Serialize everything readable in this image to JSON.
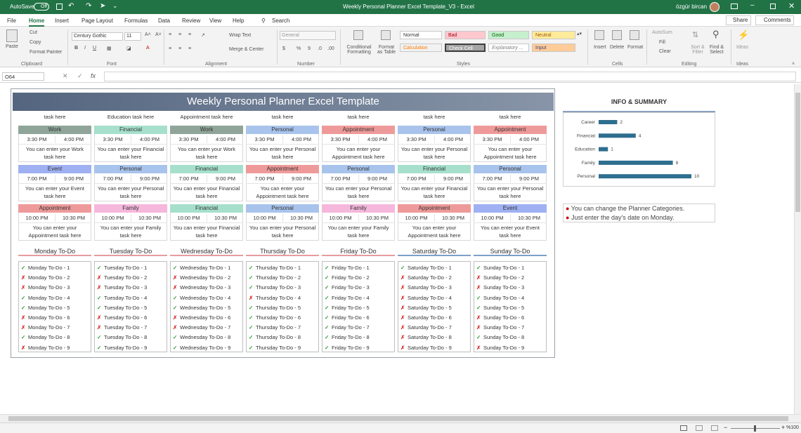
{
  "window": {
    "autosave_label": "AutoSave",
    "autosave_state": "Off",
    "title": "Weekly Personal Planner Excel Template_V3  -  Excel",
    "user": "özgür bircan"
  },
  "menu": {
    "tabs": [
      "File",
      "Home",
      "Insert",
      "Page Layout",
      "Formulas",
      "Data",
      "Review",
      "View",
      "Help"
    ],
    "search": "Search",
    "share": "Share",
    "comments": "Comments"
  },
  "ribbon": {
    "clipboard": {
      "paste": "Paste",
      "cut": "Cut",
      "copy": "Copy",
      "format_painter": "Format Painter",
      "group": "Clipboard"
    },
    "font": {
      "name": "Century Gothic",
      "size": "11",
      "group": "Font"
    },
    "alignment": {
      "wrap": "Wrap Text",
      "merge": "Merge & Center",
      "group": "Alignment"
    },
    "number": {
      "format": "General",
      "group": "Number"
    },
    "styles": {
      "cond": "Conditional Formatting",
      "table": "Format as Table",
      "normal": "Normal",
      "bad": "Bad",
      "good": "Good",
      "neutral": "Neutral",
      "calc": "Calculation",
      "check": "Check Cell",
      "expl": "Explanatory ...",
      "input": "Input",
      "group": "Styles"
    },
    "cells": {
      "insert": "Insert",
      "delete": "Delete",
      "format": "Format",
      "group": "Cells"
    },
    "editing": {
      "autosum": "AutoSum",
      "fill": "Fill",
      "clear": "Clear",
      "sort": "Sort & Filter",
      "find": "Find & Select",
      "group": "Editing"
    },
    "ideas": {
      "label": "Ideas",
      "group": "Ideas"
    }
  },
  "formula_bar": {
    "name_box": "O64",
    "value": ""
  },
  "planner": {
    "title": "Weekly Personal Planner Excel Template",
    "top_row": [
      "task here",
      "Education task here",
      "Appointment task here",
      "task here",
      "task here",
      "task here",
      "task here"
    ],
    "rows": [
      [
        {
          "cat": "Work",
          "start": "3:30 PM",
          "end": "4:00 PM",
          "desc": "You can enter your Work|task here"
        },
        {
          "cat": "Financial",
          "start": "3:30 PM",
          "end": "4:00 PM",
          "desc": "You can enter your Financial|task here"
        },
        {
          "cat": "Work",
          "start": "3:30 PM",
          "end": "4:00 PM",
          "desc": "You can enter your Work|task here"
        },
        {
          "cat": "Personal",
          "start": "3:30 PM",
          "end": "4:00 PM",
          "desc": "You can enter your Personal|task here"
        },
        {
          "cat": "Appointment",
          "start": "3:30 PM",
          "end": "4:00 PM",
          "desc": "You can enter your|Appointment task here"
        },
        {
          "cat": "Personal",
          "start": "3:30 PM",
          "end": "4:00 PM",
          "desc": "You can enter your Personal|task here"
        },
        {
          "cat": "Appointment",
          "start": "3:30 PM",
          "end": "4:00 PM",
          "desc": "You can enter your|Appointment task here"
        }
      ],
      [
        {
          "cat": "Event",
          "start": "7:00 PM",
          "end": "9:00 PM",
          "desc": "You can enter your Event|task here"
        },
        {
          "cat": "Personal",
          "start": "7:00 PM",
          "end": "9:00 PM",
          "desc": "You can enter your Personal|task here"
        },
        {
          "cat": "Financial",
          "start": "7:00 PM",
          "end": "9:00 PM",
          "desc": "You can enter your Financial|task here"
        },
        {
          "cat": "Appointment",
          "start": "7:00 PM",
          "end": "9:00 PM",
          "desc": "You can enter your|Appointment task here"
        },
        {
          "cat": "Personal",
          "start": "7:00 PM",
          "end": "9:00 PM",
          "desc": "You can enter your Personal|task here"
        },
        {
          "cat": "Financial",
          "start": "7:00 PM",
          "end": "9:00 PM",
          "desc": "You can enter your Financial|task here"
        },
        {
          "cat": "Personal",
          "start": "7:00 PM",
          "end": "9:00 PM",
          "desc": "You can enter your Personal|task here"
        }
      ],
      [
        {
          "cat": "Appointment",
          "start": "10:00 PM",
          "end": "10:30 PM",
          "desc": "You can enter your|Appointment task here"
        },
        {
          "cat": "Family",
          "start": "10:00 PM",
          "end": "10:30 PM",
          "desc": "You can enter your Family|task here"
        },
        {
          "cat": "Financial",
          "start": "10:00 PM",
          "end": "10:30 PM",
          "desc": "You can enter your Financial|task here"
        },
        {
          "cat": "Personal",
          "start": "10:00 PM",
          "end": "10:30 PM",
          "desc": "You can enter your Personal|task here"
        },
        {
          "cat": "Family",
          "start": "10:00 PM",
          "end": "10:30 PM",
          "desc": "You can enter your Family|task here"
        },
        {
          "cat": "Appointment",
          "start": "10:00 PM",
          "end": "10:30 PM",
          "desc": "You can enter your|Appointment task here"
        },
        {
          "cat": "Event",
          "start": "10:00 PM",
          "end": "10:30 PM",
          "desc": "You can enter your Event|task here"
        }
      ]
    ],
    "category_colors": {
      "Work": "#8fa59a",
      "Financial": "#a6e0cc",
      "Personal": "#a9c4ec",
      "Appointment": "#ef9a9a",
      "Event": "#9fb1f2",
      "Family": "#f5b8dc",
      "Education": "#f6d48c"
    },
    "days": [
      "Monday",
      "Tuesday",
      "Wednesday",
      "Thursday",
      "Friday",
      "Saturday",
      "Sunday"
    ],
    "todo_suffix": "To-Do",
    "checks": [
      [
        1,
        0,
        0,
        1,
        1,
        0,
        0,
        1,
        0
      ],
      [
        1,
        0,
        0,
        1,
        1,
        0,
        0,
        1,
        1
      ],
      [
        1,
        0,
        0,
        1,
        1,
        0,
        0,
        1,
        1
      ],
      [
        1,
        1,
        1,
        0,
        1,
        1,
        1,
        1,
        1
      ],
      [
        1,
        1,
        1,
        1,
        1,
        1,
        1,
        1,
        1
      ],
      [
        1,
        0,
        0,
        0,
        0,
        0,
        0,
        0,
        0
      ],
      [
        1,
        0,
        0,
        1,
        1,
        0,
        0,
        1,
        0
      ]
    ]
  },
  "info": {
    "title": "INFO & SUMMARY",
    "notes": [
      "You can change the Planner Categories.",
      "Just enter the day's date on Monday."
    ]
  },
  "chart_data": {
    "type": "bar",
    "orientation": "horizontal",
    "categories": [
      "Career",
      "Financial",
      "Education",
      "Family",
      "Personal"
    ],
    "values": [
      2,
      4,
      1,
      8,
      10
    ],
    "color": "#2e6e8e"
  },
  "status": {
    "zoom": "%100"
  }
}
